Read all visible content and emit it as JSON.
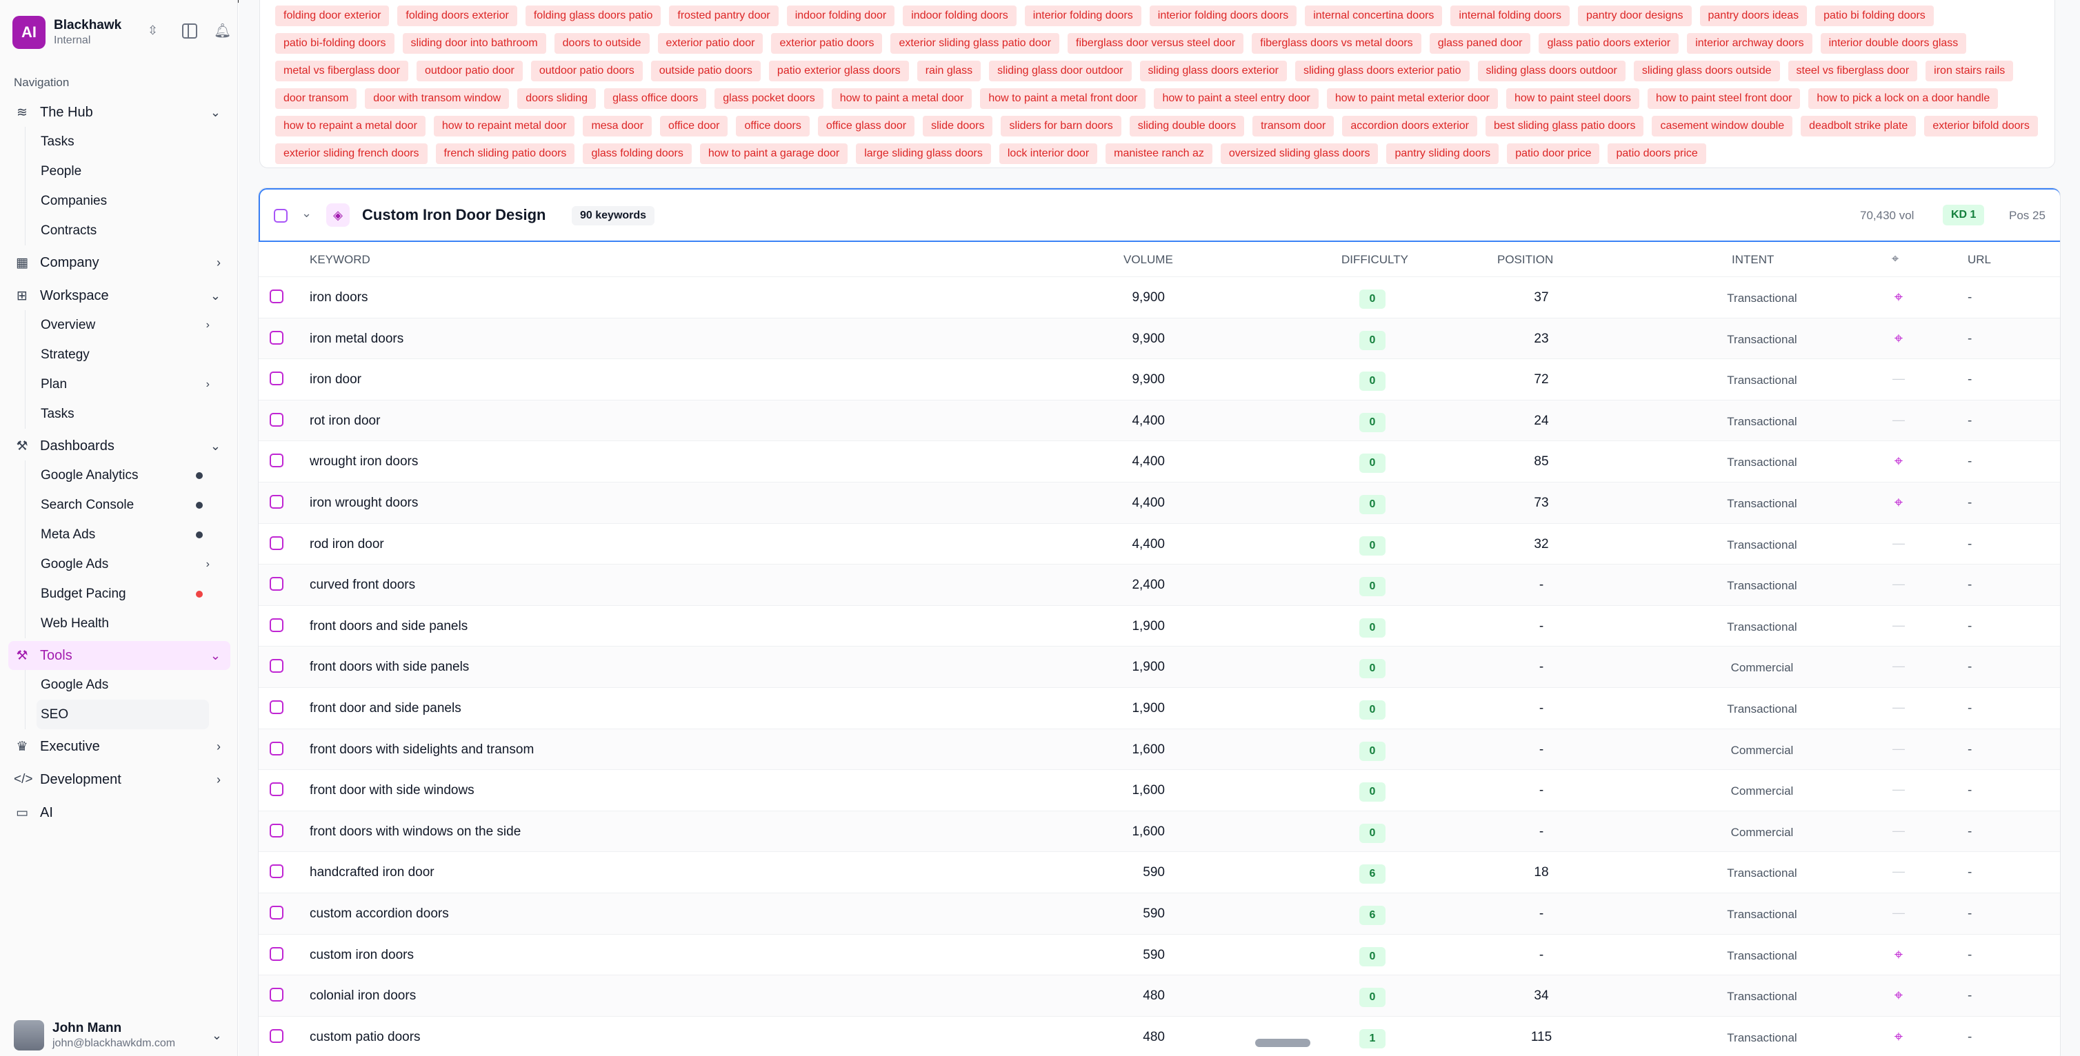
{
  "brand": {
    "logo": "AI",
    "name": "Blackhawk",
    "subtitle": "Internal"
  },
  "nav_heading": "Navigation",
  "nav": {
    "hub": {
      "label": "The Hub",
      "items": [
        "Tasks",
        "People",
        "Companies",
        "Contracts"
      ]
    },
    "company": {
      "label": "Company"
    },
    "workspace": {
      "label": "Workspace",
      "items": [
        "Overview",
        "Strategy",
        "Plan",
        "Tasks"
      ]
    },
    "dashboards": {
      "label": "Dashboards",
      "items": [
        "Google Analytics",
        "Search Console",
        "Meta Ads",
        "Google Ads",
        "Budget Pacing",
        "Web Health"
      ]
    },
    "tools": {
      "label": "Tools",
      "items": [
        "Google Ads",
        "SEO"
      ]
    },
    "executive": {
      "label": "Executive"
    },
    "development": {
      "label": "Development"
    },
    "ai": {
      "label": "AI"
    }
  },
  "user": {
    "name": "John Mann",
    "email": "john@blackhawkdm.com"
  },
  "tags": [
    "folding door exterior",
    "folding doors exterior",
    "folding glass doors patio",
    "frosted pantry door",
    "indoor folding door",
    "indoor folding doors",
    "interior folding doors",
    "interior folding doors doors",
    "internal concertina doors",
    "internal folding doors",
    "pantry door designs",
    "pantry doors ideas",
    "patio bi folding doors",
    "patio bi-folding doors",
    "sliding door into bathroom",
    "doors to outside",
    "exterior patio door",
    "exterior patio doors",
    "exterior sliding glass patio door",
    "fiberglass door versus steel door",
    "fiberglass doors vs metal doors",
    "glass paned door",
    "glass patio doors exterior",
    "interior archway doors",
    "interior double doors glass",
    "metal vs fiberglass door",
    "outdoor patio door",
    "outdoor patio doors",
    "outside patio doors",
    "patio exterior glass doors",
    "rain glass",
    "sliding glass door outdoor",
    "sliding glass doors exterior",
    "sliding glass doors exterior patio",
    "sliding glass doors outdoor",
    "sliding glass doors outside",
    "steel vs fiberglass door",
    "iron stairs rails",
    "door transom",
    "door with transom window",
    "doors sliding",
    "glass office doors",
    "glass pocket doors",
    "how to paint a metal door",
    "how to paint a metal front door",
    "how to paint a steel entry door",
    "how to paint metal exterior door",
    "how to paint steel doors",
    "how to paint steel front door",
    "how to pick a lock on a door handle",
    "how to repaint a metal door",
    "how to repaint metal door",
    "mesa door",
    "office door",
    "office doors",
    "office glass door",
    "slide doors",
    "sliders for barn doors",
    "sliding double doors",
    "transom door",
    "accordion doors exterior",
    "best sliding glass patio doors",
    "casement window double",
    "deadbolt strike plate",
    "exterior bifold doors",
    "exterior sliding french doors",
    "french sliding patio doors",
    "glass folding doors",
    "how to paint a garage door",
    "large sliding glass doors",
    "lock interior door",
    "manistee ranch az",
    "oversized sliding glass doors",
    "pantry sliding doors",
    "patio door price",
    "patio doors price"
  ],
  "group": {
    "title": "Custom Iron Door Design",
    "count": "90 keywords",
    "volume": "70,430 vol",
    "kd": "KD 1",
    "position": "Pos 25"
  },
  "columns": {
    "keyword": "KEYWORD",
    "volume": "VOLUME",
    "difficulty": "DIFFICULTY",
    "position": "POSITION",
    "intent": "INTENT",
    "url": "URL"
  },
  "rows": [
    {
      "keyword": "iron doors",
      "volume": "9,900",
      "kd": "0",
      "position": "37",
      "intent": "Transactional",
      "local": true,
      "url": "-"
    },
    {
      "keyword": "iron metal doors",
      "volume": "9,900",
      "kd": "0",
      "position": "23",
      "intent": "Transactional",
      "local": true,
      "url": "-"
    },
    {
      "keyword": "iron door",
      "volume": "9,900",
      "kd": "0",
      "position": "72",
      "intent": "Transactional",
      "local": false,
      "url": "-"
    },
    {
      "keyword": "rot iron door",
      "volume": "4,400",
      "kd": "0",
      "position": "24",
      "intent": "Transactional",
      "local": false,
      "url": "-"
    },
    {
      "keyword": "wrought iron doors",
      "volume": "4,400",
      "kd": "0",
      "position": "85",
      "intent": "Transactional",
      "local": true,
      "url": "-"
    },
    {
      "keyword": "iron wrought doors",
      "volume": "4,400",
      "kd": "0",
      "position": "73",
      "intent": "Transactional",
      "local": true,
      "url": "-"
    },
    {
      "keyword": "rod iron door",
      "volume": "4,400",
      "kd": "0",
      "position": "32",
      "intent": "Transactional",
      "local": false,
      "url": "-"
    },
    {
      "keyword": "curved front doors",
      "volume": "2,400",
      "kd": "0",
      "position": "-",
      "intent": "Transactional",
      "local": false,
      "url": "-"
    },
    {
      "keyword": "front doors and side panels",
      "volume": "1,900",
      "kd": "0",
      "position": "-",
      "intent": "Transactional",
      "local": false,
      "url": "-"
    },
    {
      "keyword": "front doors with side panels",
      "volume": "1,900",
      "kd": "0",
      "position": "-",
      "intent": "Commercial",
      "local": false,
      "url": "-"
    },
    {
      "keyword": "front door and side panels",
      "volume": "1,900",
      "kd": "0",
      "position": "-",
      "intent": "Transactional",
      "local": false,
      "url": "-"
    },
    {
      "keyword": "front doors with sidelights and transom",
      "volume": "1,600",
      "kd": "0",
      "position": "-",
      "intent": "Commercial",
      "local": false,
      "url": "-"
    },
    {
      "keyword": "front door with side windows",
      "volume": "1,600",
      "kd": "0",
      "position": "-",
      "intent": "Commercial",
      "local": false,
      "url": "-"
    },
    {
      "keyword": "front doors with windows on the side",
      "volume": "1,600",
      "kd": "0",
      "position": "-",
      "intent": "Commercial",
      "local": false,
      "url": "-"
    },
    {
      "keyword": "handcrafted iron door",
      "volume": "590",
      "kd": "6",
      "position": "18",
      "intent": "Transactional",
      "local": false,
      "url": "-"
    },
    {
      "keyword": "custom accordion doors",
      "volume": "590",
      "kd": "6",
      "position": "-",
      "intent": "Transactional",
      "local": false,
      "url": "-"
    },
    {
      "keyword": "custom iron doors",
      "volume": "590",
      "kd": "0",
      "position": "-",
      "intent": "Transactional",
      "local": true,
      "url": "-"
    },
    {
      "keyword": "colonial iron doors",
      "volume": "480",
      "kd": "0",
      "position": "34",
      "intent": "Transactional",
      "local": true,
      "url": "-"
    },
    {
      "keyword": "custom patio doors",
      "volume": "480",
      "kd": "1",
      "position": "115",
      "intent": "Transactional",
      "local": true,
      "url": "-"
    }
  ]
}
